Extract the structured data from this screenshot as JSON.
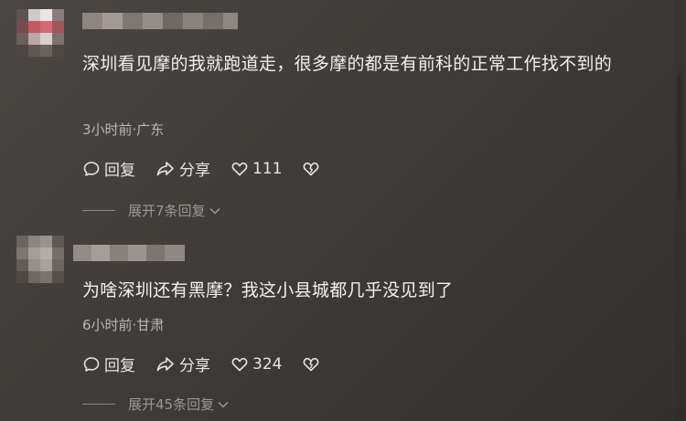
{
  "comments": [
    {
      "text": "深圳看见摩的我就跑道走，很多摩的都是有前科的正常工作找不到的",
      "time_location": "3小时前·广东",
      "reply_label": "回复",
      "share_label": "分享",
      "like_count": "111",
      "expand_label": "展开7条回复"
    },
    {
      "text": "为啥深圳还有黑摩？我这小县城都几乎没见到了",
      "time_location": "6小时前·甘肃",
      "reply_label": "回复",
      "share_label": "分享",
      "like_count": "324",
      "expand_label": "展开45条回复"
    }
  ],
  "icons": {
    "reply": "comment-bubble-icon",
    "share": "share-arrow-icon",
    "like": "heart-icon",
    "dislike": "broken-heart-icon",
    "expand": "chevron-down-icon"
  }
}
